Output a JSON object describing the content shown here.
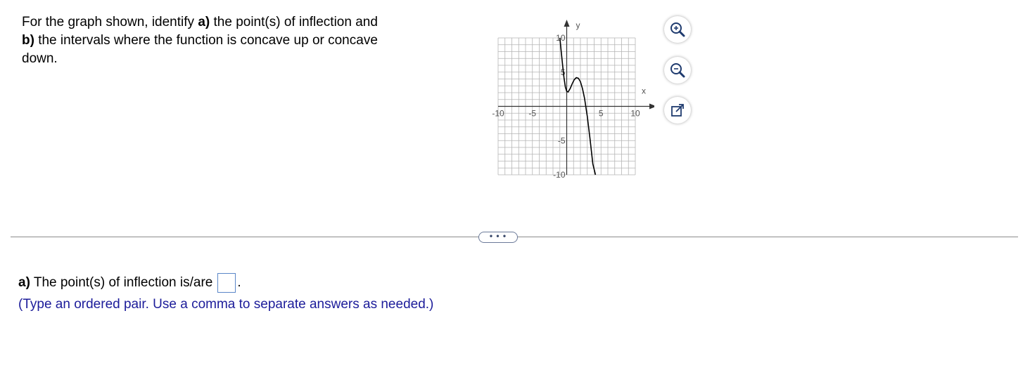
{
  "question": {
    "part1": "For the graph shown, identify ",
    "a_label": "a)",
    "part2": " the point(s) of inflection and",
    "b_label": "b)",
    "part3": " the intervals where the function is concave up or concave",
    "part4": "down."
  },
  "graph": {
    "x_axis_label": "x",
    "y_axis_label": "y",
    "x_ticks": [
      "-10",
      "-5",
      "5",
      "10"
    ],
    "y_ticks": [
      "10",
      "5",
      "-5",
      "-10"
    ]
  },
  "controls": {
    "zoom_in_icon": "zoom-in-icon",
    "zoom_out_icon": "zoom-out-icon",
    "popout_icon": "external-link-icon",
    "more_label": "• • •"
  },
  "answer": {
    "a_label": "a)",
    "prompt": " The point(s) of inflection is/are",
    "after_box": ".",
    "input_value": "",
    "hint": "(Type an ordered pair. Use a comma to separate answers as needed.)"
  },
  "colors": {
    "hint_text": "#1c1c9a",
    "input_border": "#5a86c8",
    "grid": "#b5b5b5",
    "curve": "#000000"
  }
}
